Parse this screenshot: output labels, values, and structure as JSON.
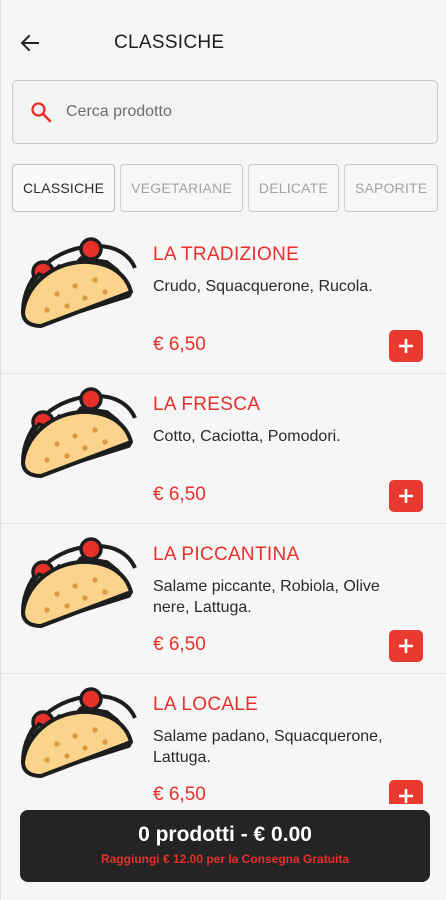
{
  "header": {
    "title": "CLASSICHE",
    "back_icon": "arrow-left-icon"
  },
  "search": {
    "placeholder": "Cerca prodotto",
    "value": "",
    "icon": "search-icon"
  },
  "categories": {
    "items": [
      {
        "label": "CLASSICHE",
        "active": true
      },
      {
        "label": "VEGETARIANE",
        "active": false
      },
      {
        "label": "DELICATE",
        "active": false
      },
      {
        "label": "SAPORITE",
        "active": false
      }
    ]
  },
  "products": [
    {
      "name": "LA TRADIZIONE",
      "description": "Crudo, Squacquerone, Rucola.",
      "price": "€ 6,50"
    },
    {
      "name": "LA FRESCA",
      "description": "Cotto, Caciotta, Pomodori.",
      "price": "€ 6,50"
    },
    {
      "name": "LA PICCANTINA",
      "description": "Salame piccante, Robiola, Olive nere, Lattuga.",
      "price": "€ 6,50"
    },
    {
      "name": "LA LOCALE",
      "description": "Salame padano, Squacquerone, Lattuga.",
      "price": "€ 6,50"
    }
  ],
  "cart": {
    "summary": "0 prodotti - € 0.00",
    "hint": "Raggiungi € 12.00 per la Consegna Gratuita"
  },
  "colors": {
    "accent": "#e8302b",
    "background": "#f6f6f6",
    "cart_background": "#242424"
  }
}
